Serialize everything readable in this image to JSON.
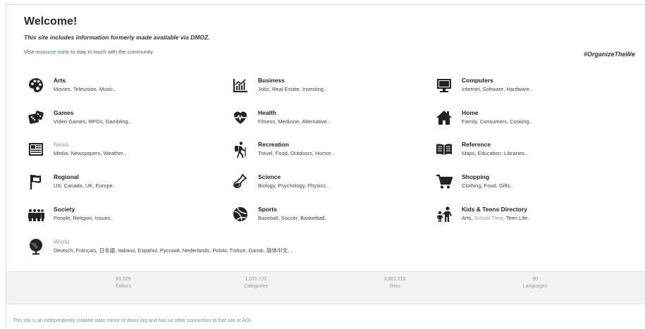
{
  "header": {
    "title": "Welcome!",
    "tagline": "This site includes information formerly made available via DMOZ.",
    "visit_prefix": "Visit ",
    "visit_link": "resource-zone",
    "visit_suffix": " to stay in touch with the community.",
    "hashtag": "#OrganizeTheWe"
  },
  "categories": [
    {
      "name": "Arts",
      "sub": "Movies, Television, Music..",
      "icon": "palette-icon"
    },
    {
      "name": "Business",
      "sub": "Jobs, Real Estate, Investing..",
      "icon": "chart-icon"
    },
    {
      "name": "Computers",
      "sub": "Internet, Software, Hardware..",
      "icon": "monitor-icon"
    },
    {
      "name": "Games",
      "sub": "Video Games, RPGs, Gambling..",
      "icon": "dice-icon"
    },
    {
      "name": "Health",
      "sub": "Fitness, Medicine, Alternative..",
      "icon": "heartbeat-icon"
    },
    {
      "name": "Home",
      "sub": "Family, Consumers, Cooking..",
      "icon": "house-icon"
    },
    {
      "name": "News",
      "sub": "Media, Newspapers, Weather..",
      "icon": "newspaper-icon"
    },
    {
      "name": "Recreation",
      "sub": "Travel, Food, Outdoors, Humor..",
      "icon": "hiker-icon"
    },
    {
      "name": "Reference",
      "sub": "Maps, Education, Libraries..",
      "icon": "book-icon"
    },
    {
      "name": "Regional",
      "sub": "US, Canada, UK, Europe..",
      "icon": "flag-icon"
    },
    {
      "name": "Science",
      "sub": "Biology, Psychology, Physics..",
      "icon": "flask-icon"
    },
    {
      "name": "Shopping",
      "sub": "Clothing, Food, Gifts..",
      "icon": "cart-icon"
    },
    {
      "name": "Society",
      "sub": "People, Religion, Issues..",
      "icon": "people-icon"
    },
    {
      "name": "Sports",
      "sub": "Baseball, Soccer, Basketball..",
      "icon": "ball-icon"
    },
    {
      "name": "Kids & Teens Directory",
      "sub_a": "Arts, ",
      "sub_b": "School Time",
      "sub_c": ", Teen Life..",
      "icon": "kids-icon"
    },
    {
      "name": "World",
      "sub": "Deutsch, Français, 日本語, Italiano, Español, Русский, Nederlands, Polski, Türkçe, Dansk, 简体中文, ..",
      "icon": "globe-icon"
    }
  ],
  "stats": [
    {
      "value": "91,929",
      "label": "Editors"
    },
    {
      "value": "1,031,722",
      "label": "Categories"
    },
    {
      "value": "3,861,210",
      "label": "Sites"
    },
    {
      "value": "90",
      "label": "Languages"
    }
  ],
  "footer": {
    "text": "This site is an independently created static mirror of dmoz.org and has no other connection to that site or AOL"
  },
  "colors": {
    "link_green": "#2e8b2e",
    "muted_gray": "#999999",
    "stats_bg": "#f2f2f2"
  }
}
